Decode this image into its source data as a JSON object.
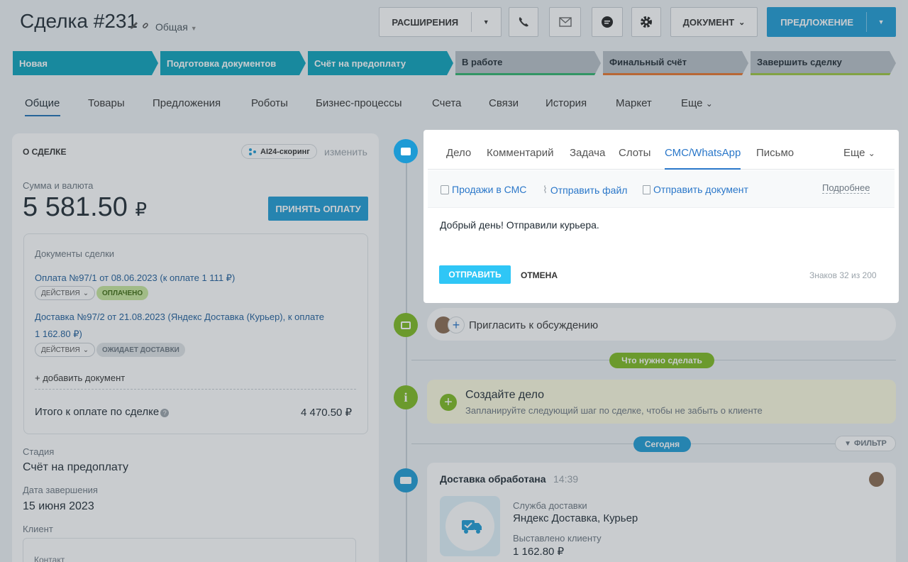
{
  "header": {
    "title": "Сделка #231",
    "category": "Общая",
    "extensions_label": "РАСШИРЕНИЯ",
    "document_label": "ДОКУМЕНТ",
    "offer_label": "ПРЕДЛОЖЕНИЕ"
  },
  "stages": [
    {
      "label": "Новая",
      "state": "done",
      "color": "#0aa2bb"
    },
    {
      "label": "Подготовка документов",
      "state": "done",
      "color": "#0aa2bb"
    },
    {
      "label": "Счёт на предоплату",
      "state": "current",
      "color": "#0aa2bb"
    },
    {
      "label": "В работе",
      "state": "todo",
      "accent": "#2fb36b"
    },
    {
      "label": "Финальный счёт",
      "state": "todo",
      "accent": "#e8742c"
    },
    {
      "label": "Завершить сделку",
      "state": "todo",
      "accent": "#9bc53d"
    }
  ],
  "tabs": [
    "Общие",
    "Товары",
    "Предложения",
    "Роботы",
    "Бизнес-процессы",
    "Счета",
    "Связи",
    "История",
    "Маркет",
    "Еще"
  ],
  "about": {
    "heading": "О СДЕЛКЕ",
    "scoring_label": "AI24-скоринг",
    "edit_label": "изменить",
    "sum_label": "Сумма и валюта",
    "sum_value": "5 581.50",
    "currency": "₽",
    "accept_payment": "ПРИНЯТЬ ОПЛАТУ",
    "docs_heading": "Документы сделки",
    "doc1_title": "Оплата №97/1 от 08.06.2023 (к оплате 1 111 ₽)",
    "doc1_action": "ДЕЙСТВИЯ",
    "doc1_status": "ОПЛАЧЕНО",
    "doc2_title_line1": "Доставка №97/2 от 21.08.2023 (Яндекс Доставка (Курьер), к оплате",
    "doc2_title_line2": "1 162.80 ₽)",
    "doc2_action": "ДЕЙСТВИЯ",
    "doc2_status": "ОЖИДАЕТ ДОСТАВКИ",
    "add_document": "+ добавить документ",
    "total_label": "Итого к оплате по сделке",
    "total_value": "4 470.50 ₽",
    "stage_label": "Стадия",
    "stage_value": "Счёт на предоплату",
    "close_label": "Дата завершения",
    "close_value": "15 июня 2023",
    "client_label": "Клиент",
    "contact_label": "Контакт"
  },
  "editor": {
    "tabs": [
      "Дело",
      "Комментарий",
      "Задача",
      "Слоты",
      "СМС/WhatsApp",
      "Письмо"
    ],
    "more": "Еще",
    "action_sales": "Продажи в СМС",
    "action_file": "Отправить файл",
    "action_doc": "Отправить документ",
    "details": "Подробнее",
    "message": "Добрый день! Отправили курьера.",
    "send": "ОТПРАВИТЬ",
    "cancel": "ОТМЕНА",
    "counter": "Знаков 32 из 200"
  },
  "timeline": {
    "invite": "Пригласить к обсуждению",
    "todo_pill": "Что нужно сделать",
    "create_title": "Создайте дело",
    "create_sub": "Запланируйте следующий шаг по сделке, чтобы не забыть о клиенте",
    "today_pill": "Сегодня",
    "filter": "ФИЛЬТР",
    "delivery_title": "Доставка обработана",
    "delivery_time": "14:39",
    "service_label": "Служба доставки",
    "service_value": "Яндекс Доставка, Курьер",
    "billed_label": "Выставлено клиенту",
    "billed_value": "1 162.80 ₽"
  }
}
